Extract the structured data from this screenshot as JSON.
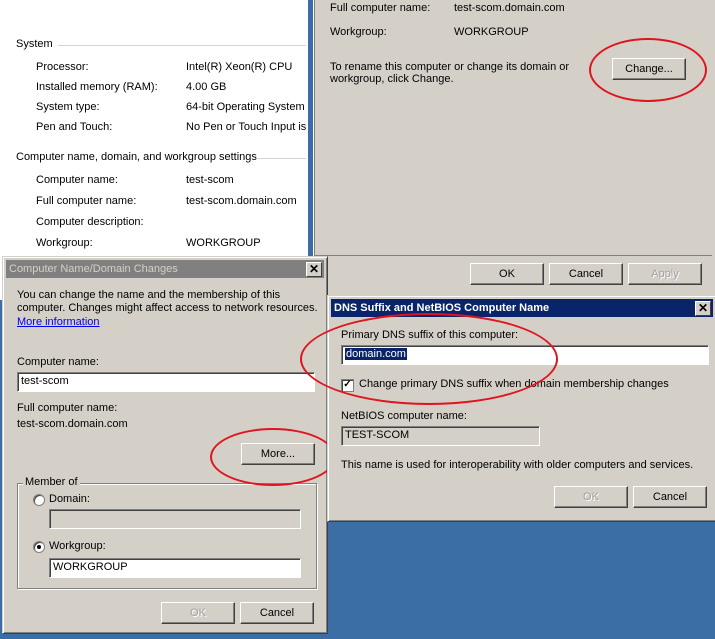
{
  "system_page": {
    "system_heading": "System",
    "rows": [
      {
        "label": "Processor:",
        "value": "Intel(R) Xeon(R) CPU"
      },
      {
        "label": "Installed memory (RAM):",
        "value": "4.00 GB"
      },
      {
        "label": "System type:",
        "value": "64-bit Operating System"
      },
      {
        "label": "Pen and Touch:",
        "value": "No Pen or Touch Input is"
      }
    ],
    "cn_heading": "Computer name, domain, and workgroup settings",
    "cn_rows": [
      {
        "label": "Computer name:",
        "value": "test-scom"
      },
      {
        "label": "Full computer name:",
        "value": "test-scom.domain.com"
      },
      {
        "label": "Computer description:",
        "value": ""
      },
      {
        "label": "Workgroup:",
        "value": "WORKGROUP"
      }
    ]
  },
  "system_properties": {
    "full_name_label": "Full computer name:",
    "full_name_value": "test-scom.domain.com",
    "workgroup_label": "Workgroup:",
    "workgroup_value": "WORKGROUP",
    "rename_text_1": "To rename this computer or change its domain or",
    "rename_text_2": "workgroup, click Change.",
    "change_button": "Change...",
    "ok_button": "OK",
    "cancel_button": "Cancel",
    "apply_button": "Apply"
  },
  "cn_dialog": {
    "title": "Computer Name/Domain Changes",
    "close": "✕",
    "desc_1": "You can change the name and the membership of this",
    "desc_2": "computer. Changes might affect access to network resources.",
    "more_info_link": "More information",
    "computer_name_label": "Computer name:",
    "computer_name_value": "test-scom",
    "full_name_label": "Full computer name:",
    "full_name_value": "test-scom.domain.com",
    "more_button": "More...",
    "member_of_label": "Member of",
    "domain_label": "Domain:",
    "domain_value": "",
    "workgroup_label": "Workgroup:",
    "workgroup_value": "WORKGROUP",
    "ok_button": "OK",
    "cancel_button": "Cancel"
  },
  "dns_dialog": {
    "title": "DNS Suffix and NetBIOS Computer Name",
    "close": "✕",
    "primary_label": "Primary DNS suffix of this computer:",
    "primary_value": "domain.com",
    "checkbox_label": "Change primary DNS suffix when domain membership changes",
    "checkbox_checked": true,
    "netbios_label": "NetBIOS computer name:",
    "netbios_value": "TEST-SCOM",
    "info_text": "This name is used for interoperability with older computers and services.",
    "ok_button": "OK",
    "cancel_button": "Cancel"
  },
  "colors": {
    "annotation_red": "#e0141e",
    "dialog_grey": "#d4d0c8",
    "active_title": "#0a246a",
    "desktop_blue": "#3a6ea5"
  }
}
